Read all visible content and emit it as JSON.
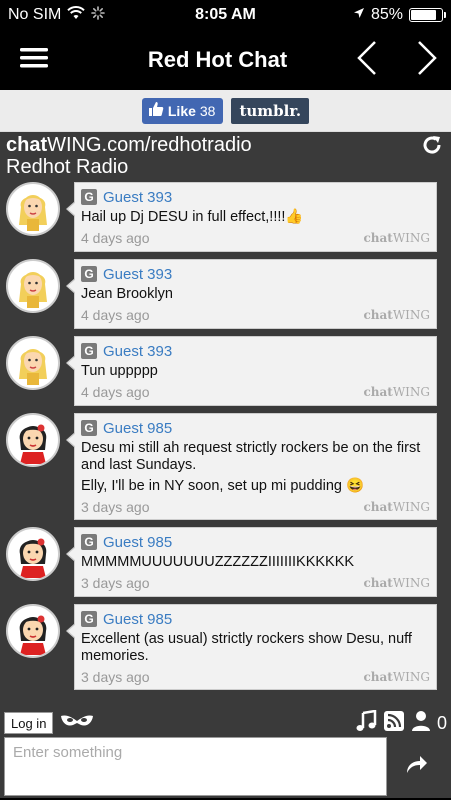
{
  "status": {
    "carrier": "No SIM",
    "time": "8:05 AM",
    "battery_text": "85%",
    "battery_level": 0.85
  },
  "nav": {
    "title": "Red Hot Chat"
  },
  "share": {
    "like_label": "Like",
    "like_count": "38",
    "tumblr_label": "tumblr."
  },
  "chat": {
    "url_bold": "chat",
    "url_rest": "WING.com/redhotradio",
    "room": "Redhot Radio"
  },
  "messages": [
    {
      "badge": "G",
      "user": "Guest 393",
      "text": "Hail up Dj DESU in full effect,!!!!👍",
      "time": "4 days ago",
      "avatar": "blonde"
    },
    {
      "badge": "G",
      "user": "Guest 393",
      "text": "Jean Brooklyn",
      "time": "4 days ago",
      "avatar": "blonde"
    },
    {
      "badge": "G",
      "user": "Guest 393",
      "text": "Tun uppppp",
      "time": "4 days ago",
      "avatar": "blonde"
    },
    {
      "badge": "G",
      "user": "Guest 985",
      "text": "Desu mi still ah request strictly rockers be on the first and last Sundays.",
      "text2": "Elly, I'll be in NY soon, set up mi pudding 😆",
      "time": "3 days ago",
      "avatar": "dark"
    },
    {
      "badge": "G",
      "user": "Guest 985",
      "text": "MMMMMUUUUUUUZZZZZZIIIIIIIKKKKKK",
      "time": "3 days ago",
      "avatar": "dark"
    },
    {
      "badge": "G",
      "user": "Guest 985",
      "text": "Excellent (as usual) strictly rockers show Desu, nuff memories.",
      "time": "3 days ago",
      "avatar": "dark"
    }
  ],
  "brand": {
    "bold": "chat",
    "rest": "WING"
  },
  "bottom": {
    "login_label": "Log in",
    "user_count": "0"
  },
  "input": {
    "placeholder": "Enter something"
  }
}
